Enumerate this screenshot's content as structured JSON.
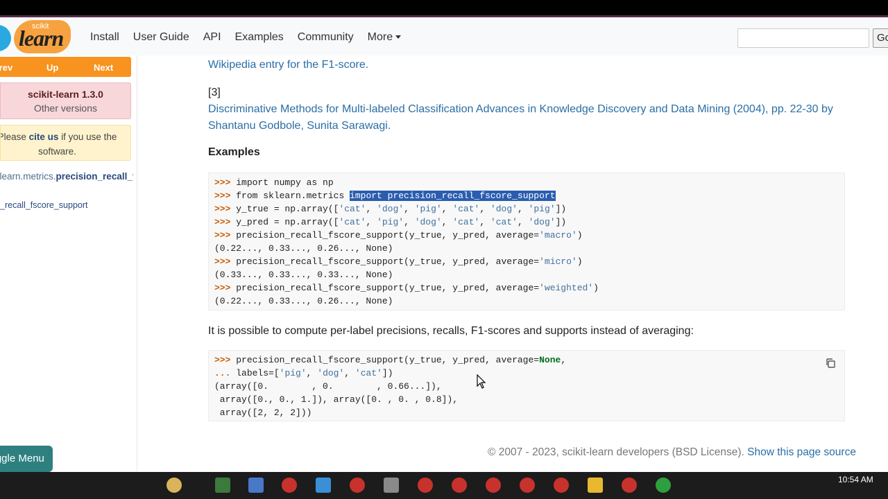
{
  "nav": {
    "logo_small": "scikit",
    "logo_big": "learn",
    "links": [
      "Install",
      "User Guide",
      "API",
      "Examples",
      "Community"
    ],
    "more": "More",
    "go": "Go"
  },
  "sidebar": {
    "prev": "Prev",
    "up": "Up",
    "next": "Next",
    "version": "scikit-learn 1.3.0",
    "other_versions": "Other versions",
    "cite_pre": "Please ",
    "cite_link": "cite us",
    "cite_post": " if you use the software.",
    "toc_module": "sklearn.metrics.",
    "toc_func": "precision_recall_fscore_support",
    "toc_sub": "precision_recall_fscore_support",
    "toggle": "Toggle Menu"
  },
  "content": {
    "ref2_text": "Wikipedia entry for the F1-score.",
    "ref3_num": "[3]",
    "ref3_line1": "Discriminative Methods for Multi-labeled Classification Advances in Knowledge Discovery and Data Mining (2004), pp. 22-30 by",
    "ref3_line2": "Shantanu Godbole, Sunita Sarawagi.",
    "examples_heading": "Examples",
    "per_label_text": "It is possible to compute per-label precisions, recalls, F1-scores and supports instead of averaging:"
  },
  "code1": [
    [
      [
        "p",
        ">>> "
      ],
      [
        "t",
        "import numpy as np"
      ]
    ],
    [
      [
        "p",
        ">>> "
      ],
      [
        "t",
        "from sklearn.metrics "
      ],
      [
        "h",
        "import precision_recall_fscore_support"
      ]
    ],
    [
      [
        "p",
        ">>> "
      ],
      [
        "t",
        "y_true = np.array(["
      ],
      [
        "s",
        "'cat'"
      ],
      [
        "t",
        ", "
      ],
      [
        "s",
        "'dog'"
      ],
      [
        "t",
        ", "
      ],
      [
        "s",
        "'pig'"
      ],
      [
        "t",
        ", "
      ],
      [
        "s",
        "'cat'"
      ],
      [
        "t",
        ", "
      ],
      [
        "s",
        "'dog'"
      ],
      [
        "t",
        ", "
      ],
      [
        "s",
        "'pig'"
      ],
      [
        "t",
        "])"
      ]
    ],
    [
      [
        "p",
        ">>> "
      ],
      [
        "t",
        "y_pred = np.array(["
      ],
      [
        "s",
        "'cat'"
      ],
      [
        "t",
        ", "
      ],
      [
        "s",
        "'pig'"
      ],
      [
        "t",
        ", "
      ],
      [
        "s",
        "'dog'"
      ],
      [
        "t",
        ", "
      ],
      [
        "s",
        "'cat'"
      ],
      [
        "t",
        ", "
      ],
      [
        "s",
        "'cat'"
      ],
      [
        "t",
        ", "
      ],
      [
        "s",
        "'dog'"
      ],
      [
        "t",
        "])"
      ]
    ],
    [
      [
        "p",
        ">>> "
      ],
      [
        "t",
        "precision_recall_fscore_support(y_true, y_pred, average="
      ],
      [
        "s",
        "'macro'"
      ],
      [
        "t",
        ")"
      ]
    ],
    [
      [
        "t",
        "(0.22..., 0.33..., 0.26..., None)"
      ]
    ],
    [
      [
        "p",
        ">>> "
      ],
      [
        "t",
        "precision_recall_fscore_support(y_true, y_pred, average="
      ],
      [
        "s",
        "'micro'"
      ],
      [
        "t",
        ")"
      ]
    ],
    [
      [
        "t",
        "(0.33..., 0.33..., 0.33..., None)"
      ]
    ],
    [
      [
        "p",
        ">>> "
      ],
      [
        "t",
        "precision_recall_fscore_support(y_true, y_pred, average="
      ],
      [
        "s",
        "'weighted'"
      ],
      [
        "t",
        ")"
      ]
    ],
    [
      [
        "t",
        "(0.22..., 0.33..., 0.26..., None)"
      ]
    ]
  ],
  "code2": [
    [
      [
        "p",
        ">>> "
      ],
      [
        "t",
        "precision_recall_fscore_support(y_true, y_pred, average="
      ],
      [
        "k",
        "None"
      ],
      [
        "t",
        ","
      ]
    ],
    [
      [
        "p",
        "... "
      ],
      [
        "t",
        "labels=["
      ],
      [
        "s",
        "'pig'"
      ],
      [
        "t",
        ", "
      ],
      [
        "s",
        "'dog'"
      ],
      [
        "t",
        ", "
      ],
      [
        "s",
        "'cat'"
      ],
      [
        "t",
        "])"
      ]
    ],
    [
      [
        "t",
        "(array([0.        , 0.        , 0.66...]),"
      ]
    ],
    [
      [
        "t",
        " array([0., 0., 1.]), array([0. , 0. , 0.8]),"
      ]
    ],
    [
      [
        "t",
        " array([2, 2, 2]))"
      ]
    ]
  ],
  "footer": {
    "copyright": "© 2007 - 2023, scikit-learn developers (BSD License).",
    "source_link": "Show this page source"
  },
  "taskbar": {
    "time": "10:54 AM"
  },
  "colors": {
    "accent_orange": "#f7931e",
    "link_blue": "#2a6ea6",
    "prompt_orange": "#c65d09",
    "string_blue": "#4070a0",
    "toggle_teal": "#2e8080"
  }
}
